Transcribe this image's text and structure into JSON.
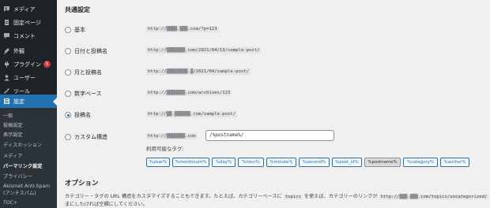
{
  "sidebar": {
    "items": [
      {
        "label": "メディア",
        "icon": "media-icon"
      },
      {
        "label": "固定ページ",
        "icon": "page-icon"
      },
      {
        "label": "コメント",
        "icon": "comment-icon"
      },
      {
        "label": "外観",
        "icon": "appearance-icon"
      },
      {
        "label": "プラグイン",
        "icon": "plugin-icon",
        "badge": "5"
      },
      {
        "label": "ユーザー",
        "icon": "user-icon"
      },
      {
        "label": "ツール",
        "icon": "tool-icon"
      },
      {
        "label": "設定",
        "icon": "settings-icon",
        "active": true
      }
    ],
    "submenu": [
      {
        "label": "一般"
      },
      {
        "label": "投稿設定"
      },
      {
        "label": "表示設定"
      },
      {
        "label": "ディスカッション"
      },
      {
        "label": "メディア"
      },
      {
        "label": "パーマリンク設定",
        "current": true
      },
      {
        "label": "プライバシー"
      },
      {
        "label": "Akismet Anti-Spam (アンチスパム)"
      },
      {
        "label": "TOC+"
      }
    ]
  },
  "main": {
    "common_title": "共通設定",
    "rows": [
      {
        "label": "基本",
        "code": "http://▒▒▒▒.▒▒▒.com/?p=123",
        "checked": false
      },
      {
        "label": "日付と投稿名",
        "code": "http://▒▒▒▒▒▒▒.com/2021/04/13/sample-post/",
        "checked": false
      },
      {
        "label": "月と投稿名",
        "code": "http://▒▒▒▒▒▒▒▒.▒/2021/04/sample-post/",
        "checked": false
      },
      {
        "label": "数字ベース",
        "code": "http://▒▒▒▒▒▒▒.com/archives/123",
        "checked": false
      },
      {
        "label": "投稿名",
        "code": "http://▒▒.▒▒▒▒▒▒.com/sample-post/",
        "checked": true
      },
      {
        "label": "カスタム構造",
        "code": "http://▒▒▒▒▒▒▒.com",
        "checked": false
      }
    ],
    "custom_value": "/%postname%/",
    "available_tags_label": "利用可能なタグ:",
    "tags": [
      {
        "label": "%year%"
      },
      {
        "label": "%monthnum%"
      },
      {
        "label": "%day%"
      },
      {
        "label": "%hour%"
      },
      {
        "label": "%minute%"
      },
      {
        "label": "%second%"
      },
      {
        "label": "%post_id%"
      },
      {
        "label": "%postname%",
        "on": true
      },
      {
        "label": "%category%"
      },
      {
        "label": "%author%"
      }
    ],
    "options_title": "オプション",
    "options_desc_1": "カテゴリー・タグの URL 構造をカスタマイズすることもできます。たとえば、カテゴリーベースに",
    "options_code_1": "topics",
    "options_desc_2": "を使えば、カテゴリーのリンクが",
    "options_code_2": "http://▒▒▒.▒▒▒.com/topics/uncategorized/",
    "options_desc_3": "まにしたければ空欄にしてください。"
  },
  "colors": {
    "sidebar_bg": "#1d2327",
    "submenu_bg": "#2c3338",
    "accent": "#2271b1",
    "badge": "#d63638",
    "page_bg": "#f0f0f1"
  }
}
